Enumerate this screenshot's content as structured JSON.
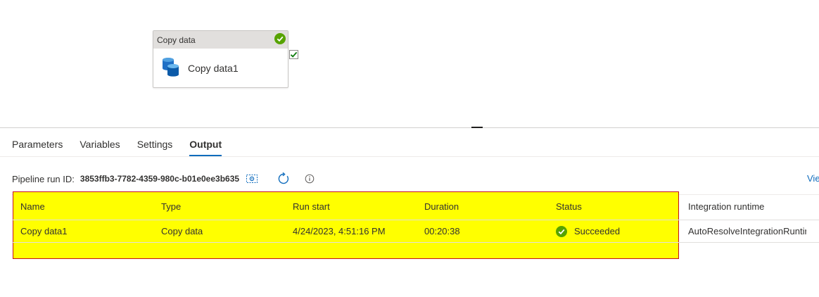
{
  "activity": {
    "header_label": "Copy data",
    "name": "Copy data1"
  },
  "tabs": [
    "Parameters",
    "Variables",
    "Settings",
    "Output"
  ],
  "active_tab": "Output",
  "run": {
    "label": "Pipeline run ID:",
    "id": "3853ffb3-7782-4359-980c-b01e0ee3b635"
  },
  "view_link": "Vie",
  "table": {
    "columns": [
      "Name",
      "Type",
      "Run start",
      "Duration",
      "Status",
      "Integration runtime"
    ],
    "rows": [
      {
        "name": "Copy data1",
        "type": "Copy data",
        "run_start": "4/24/2023, 4:51:16 PM",
        "duration": "00:20:38",
        "status": "Succeeded",
        "integration_runtime": "AutoResolveIntegrationRuntir"
      }
    ]
  },
  "colors": {
    "accent": "#0f6cbd",
    "success": "#57a300",
    "highlight": "#ffff00",
    "highlight_border": "#c50f1f"
  },
  "icons": {
    "activity_status": "success-check-circle-icon",
    "activity_type": "copy-data-database-icon",
    "side_check": "checkbox-checked-icon",
    "copy_run_id": "copy-icon",
    "refresh": "refresh-icon",
    "info": "info-icon",
    "row_status": "success-check-circle-icon"
  }
}
